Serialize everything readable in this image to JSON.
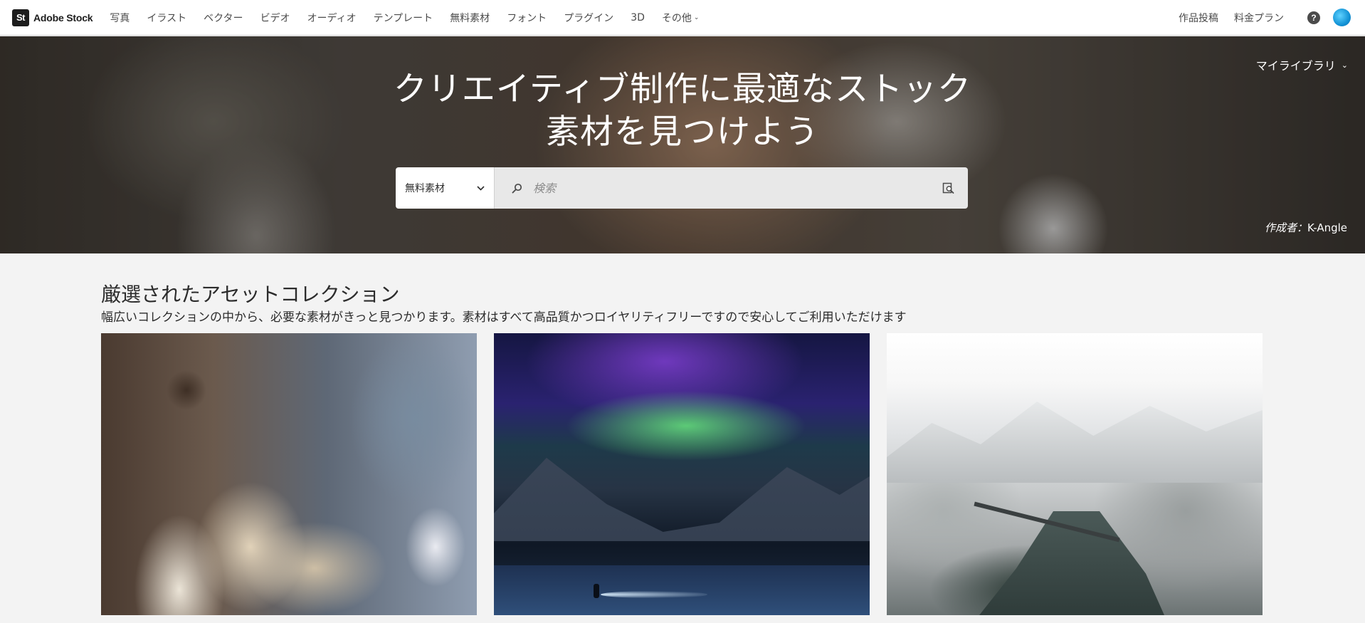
{
  "logo": {
    "mark": "St",
    "name": "Adobe Stock"
  },
  "nav": {
    "links": [
      "写真",
      "イラスト",
      "ベクター",
      "ビデオ",
      "オーディオ",
      "テンプレート",
      "無料素材",
      "フォント",
      "プラグイン",
      "3D"
    ],
    "more_label": "その他",
    "right": {
      "submit": "作品投稿",
      "pricing": "料金プラン",
      "help": "?"
    }
  },
  "hero": {
    "title_line1": "クリエイティブ制作に最適なストック",
    "title_line2": "素材を見つけよう",
    "my_library": "マイライブラリ",
    "credit_prefix": "作成者：",
    "credit_name": "K-Angle"
  },
  "search": {
    "category": "無料素材",
    "placeholder": "検索"
  },
  "collection": {
    "title": "厳選されたアセットコレクション",
    "subtitle": "幅広いコレクションの中から、必要な素材がきっと見つかります。素材はすべて高品質かつロイヤリティフリーですので安心してご利用いただけます"
  },
  "icons": {
    "search": "search-icon",
    "visual_search": "visual-search-icon",
    "chevron": "chevron-down-icon",
    "help": "help-icon"
  },
  "colors": {
    "nav_bg": "#ffffff",
    "page_bg": "#f3f3f3",
    "avatar": "#1393d6"
  }
}
